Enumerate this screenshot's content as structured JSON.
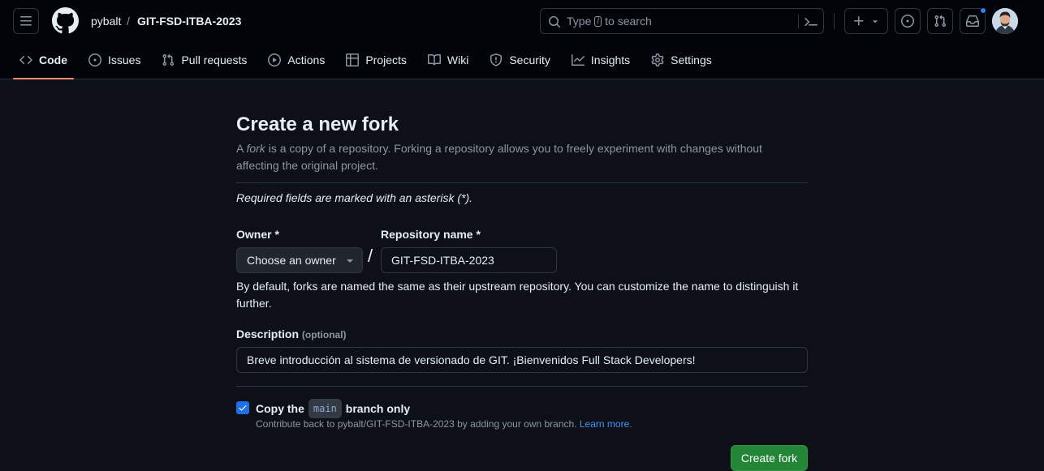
{
  "header": {
    "owner": "pybalt",
    "separator": "/",
    "repo": "GIT-FSD-ITBA-2023",
    "search": {
      "prefix": "Type",
      "key": "/",
      "suffix": "to search"
    },
    "icons": {
      "menu": "hamburger-icon",
      "logo": "github-mark-icon",
      "search": "search-icon",
      "command_palette": "terminal-icon",
      "create": "plus-icon",
      "issues": "issue-opened-icon",
      "pull_requests": "git-pull-request-icon",
      "inbox": "inbox-icon"
    },
    "notification_dot_color": "#2f81f7"
  },
  "repo_nav": [
    {
      "label": "Code",
      "icon": "code-icon",
      "active": true
    },
    {
      "label": "Issues",
      "icon": "issue-opened-icon",
      "active": false
    },
    {
      "label": "Pull requests",
      "icon": "git-pull-request-icon",
      "active": false
    },
    {
      "label": "Actions",
      "icon": "play-icon",
      "active": false
    },
    {
      "label": "Projects",
      "icon": "table-icon",
      "active": false
    },
    {
      "label": "Wiki",
      "icon": "book-icon",
      "active": false
    },
    {
      "label": "Security",
      "icon": "shield-icon",
      "active": false
    },
    {
      "label": "Insights",
      "icon": "graph-icon",
      "active": false
    },
    {
      "label": "Settings",
      "icon": "gear-icon",
      "active": false
    }
  ],
  "form": {
    "title": "Create a new fork",
    "intro_prefix": "A",
    "intro_em": "fork",
    "intro_rest": "is a copy of a repository. Forking a repository allows you to freely experiment with changes without affecting the original project.",
    "required_note": "Required fields are marked with an asterisk (*).",
    "owner_label": "Owner *",
    "owner_value": "Choose an owner",
    "slash": "/",
    "repo_label": "Repository name *",
    "repo_value": "GIT-FSD-ITBA-2023",
    "name_help": "By default, forks are named the same as their upstream repository. You can customize the name to distinguish it further.",
    "description_label": "Description",
    "description_optional": "(optional)",
    "description_value": "Breve introducción al sistema de versionado de GIT. ¡Bienvenidos Full Stack Developers!",
    "copy_prefix": "Copy the",
    "copy_branch": "main",
    "copy_suffix": "branch only",
    "copy_checked": true,
    "copy_help": "Contribute back to pybalt/GIT-FSD-ITBA-2023 by adding your own branch.",
    "learn_more": "Learn more.",
    "submit_label": "Create fork"
  },
  "colors": {
    "accent_underline": "#fd8c73",
    "primary_button": "#238636",
    "link": "#4493f8",
    "checkbox": "#1f6feb"
  }
}
